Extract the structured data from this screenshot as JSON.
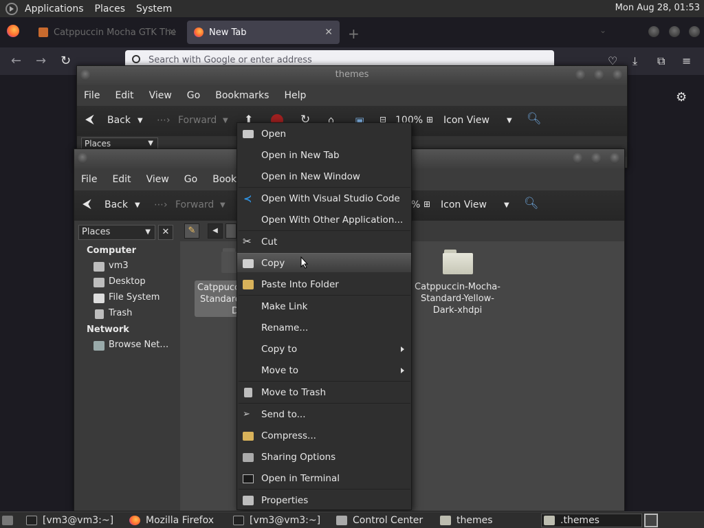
{
  "top_panel": {
    "menus": [
      "Applications",
      "Places",
      "System"
    ],
    "clock": "Mon Aug 28, 01:53"
  },
  "firefox": {
    "tabs": [
      {
        "label": "Catppuccin Mocha GTK The",
        "active": false
      },
      {
        "label": "New Tab",
        "active": true
      }
    ],
    "url_placeholder": "Search with Google or enter address"
  },
  "back_window": {
    "title": "themes",
    "menus": [
      "File",
      "Edit",
      "View",
      "Go",
      "Bookmarks",
      "Help"
    ],
    "toolbar": {
      "back": "Back",
      "forward": "Forward",
      "zoom": "100%",
      "view_mode": "Icon View"
    },
    "places": "Places"
  },
  "front_window": {
    "menus": [
      "File",
      "Edit",
      "View",
      "Go",
      "Bookmar"
    ],
    "toolbar": {
      "back": "Back",
      "forward": "Forward",
      "zoom": "%",
      "view_mode": "Icon View"
    },
    "sidebar": {
      "places_label": "Places",
      "computer_heading": "Computer",
      "computer_items": [
        "vm3",
        "Desktop",
        "File System",
        "Trash"
      ],
      "network_heading": "Network",
      "network_items": [
        "Browse Net…"
      ]
    },
    "files": [
      {
        "name_lines": [
          "Catppucc",
          "Standard",
          "Da"
        ],
        "selected": true
      },
      {
        "name_lines": [
          "Catppuccin-Mocha-",
          "Standard-Yellow-",
          "Dark-xhdpi"
        ],
        "selected": false
      }
    ]
  },
  "context_menu": {
    "items": [
      {
        "label": "Open",
        "icon": "folder-open-icon"
      },
      {
        "label": "Open in New Tab",
        "icon": ""
      },
      {
        "label": "Open in New Window",
        "icon": ""
      },
      {
        "label": "Open With Visual Studio Code",
        "icon": "vscode-icon"
      },
      {
        "label": "Open With Other Application...",
        "icon": ""
      },
      {
        "label": "Cut",
        "icon": "scissors-icon"
      },
      {
        "label": "Copy",
        "icon": "copy-icon",
        "hover": true
      },
      {
        "label": "Paste Into Folder",
        "icon": "paste-icon"
      },
      {
        "label": "Make Link",
        "icon": ""
      },
      {
        "label": "Rename...",
        "icon": ""
      },
      {
        "label": "Copy to",
        "icon": "",
        "submenu": true
      },
      {
        "label": "Move to",
        "icon": "",
        "submenu": true
      },
      {
        "label": "Move to Trash",
        "icon": "trash-icon"
      },
      {
        "label": "Send to...",
        "icon": "send-icon"
      },
      {
        "label": "Compress...",
        "icon": "archive-icon"
      },
      {
        "label": "Sharing Options",
        "icon": "share-folder-icon"
      },
      {
        "label": "Open in Terminal",
        "icon": "terminal-icon"
      },
      {
        "label": "Properties",
        "icon": "properties-icon"
      }
    ]
  },
  "taskbar": {
    "items": [
      {
        "label": "[vm3@vm3:~]",
        "icon": "terminal-icon"
      },
      {
        "label": "Mozilla Firefox",
        "icon": "firefox-icon"
      },
      {
        "label": "[vm3@vm3:~]",
        "icon": "terminal-icon"
      },
      {
        "label": "Control Center",
        "icon": "control-center-icon"
      },
      {
        "label": "themes",
        "icon": "folder-icon"
      },
      {
        "label": ".themes",
        "icon": "folder-icon",
        "active": true
      }
    ]
  },
  "colors": {
    "panel": "#2e2e2e",
    "firefox_bg": "#1c1b22",
    "window_bg": "#3a3a3a",
    "menu_bg": "#2f2f2f",
    "folder": "#d6d6c8",
    "vscode_blue": "#2f8fdc"
  }
}
